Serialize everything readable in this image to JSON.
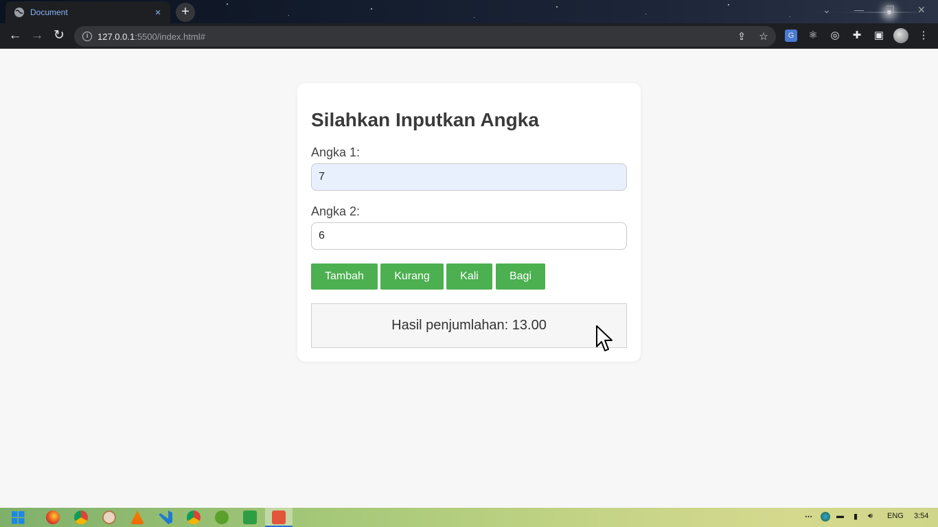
{
  "browser": {
    "tab_title": "Document",
    "tab_close": "×",
    "new_tab": "+",
    "url_host": "127.0.0.1",
    "url_rest": ":5500/index.html#"
  },
  "page": {
    "heading": "Silahkan Inputkan Angka",
    "angka1_label": "Angka 1:",
    "angka1_value": "7",
    "angka2_label": "Angka 2:",
    "angka2_value": "6",
    "buttons": {
      "tambah": "Tambah",
      "kurang": "Kurang",
      "kali": "Kali",
      "bagi": "Bagi"
    },
    "result": "Hasil penjumlahan: 13.00"
  },
  "taskbar": {
    "language": "ENG",
    "time": "3:54"
  },
  "colors": {
    "button_green": "#4caf50",
    "accent_blue": "#8ab4f8"
  }
}
